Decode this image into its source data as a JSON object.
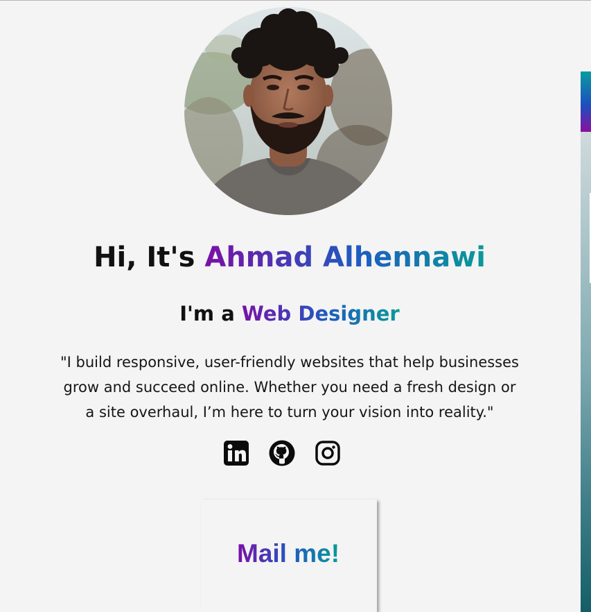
{
  "hero": {
    "greeting": "Hi, It's ",
    "name": "Ahmad Alhennawi",
    "role_prefix": "I'm a ",
    "role": "Web Designer",
    "bio": "\"I build responsive, user-friendly websites that help businesses grow and succeed online. Whether you need a fresh design or a site overhaul, I’m here to turn your vision into reality.\""
  },
  "socials": [
    {
      "icon": "linkedin-icon"
    },
    {
      "icon": "github-icon"
    },
    {
      "icon": "instagram-icon"
    }
  ],
  "contact": {
    "mail_label": "Mail me!"
  },
  "colors": {
    "background": "#f4f4f4",
    "gradient_start": "#7b10a6",
    "gradient_mid": "#1d5cc0",
    "gradient_end": "#0a9a98",
    "text": "#111111"
  }
}
